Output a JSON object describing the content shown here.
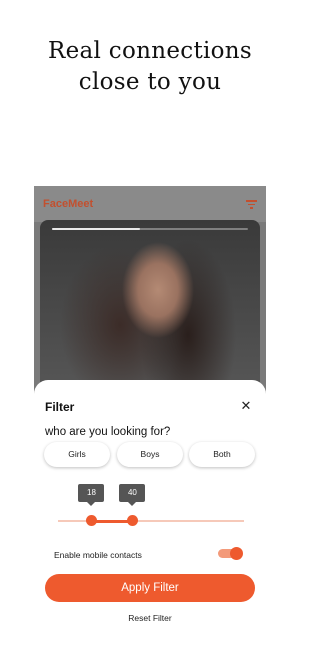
{
  "headline": {
    "line1": "Real connections",
    "line2": "close to you"
  },
  "app": {
    "name": "FaceMeet",
    "filter_icon": "filter-lines-icon"
  },
  "photo": {
    "progress": 0.45
  },
  "filter": {
    "title": "Filter",
    "close_icon": "close-icon",
    "question": "who are you looking for?",
    "options": [
      "Girls",
      "Boys",
      "Both"
    ],
    "selected": "Both",
    "age": {
      "min": 18,
      "max": 40,
      "min_label": "18",
      "max_label": "40",
      "range_min": 0,
      "range_max": 100
    },
    "mobile_contacts_label": "Enable mobile contacts",
    "mobile_contacts_on": true,
    "apply_label": "Apply Filter",
    "reset_label": "Reset Filter"
  },
  "colors": {
    "accent": "#ee5a2e",
    "accent_light": "#f6c9b9",
    "overlay": "#7a7a7a",
    "tooltip": "#555555"
  }
}
